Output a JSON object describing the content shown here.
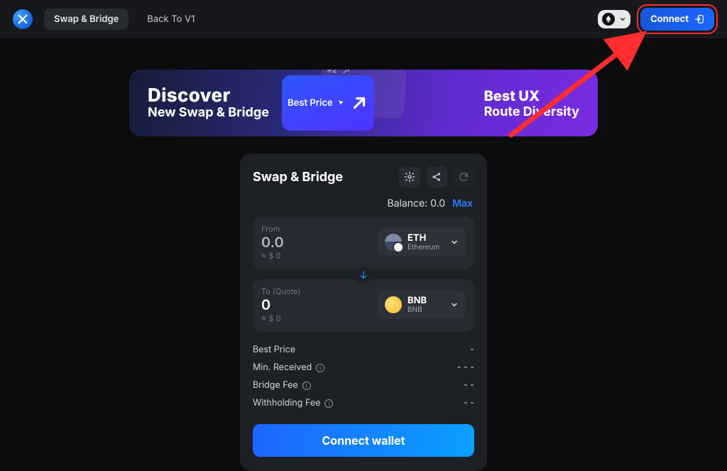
{
  "header": {
    "nav_swap_bridge": "Swap & Bridge",
    "nav_back_v1": "Back To V1",
    "connect_label": "Connect"
  },
  "banner": {
    "discover": "Discover",
    "subtitle": "New Swap & Bridge",
    "card_label": "Best Price",
    "card_back_label": "#2",
    "right1": "Best UX",
    "right2": "Route Diversity"
  },
  "swap": {
    "title": "Swap & Bridge",
    "balance_label": "Balance: 0.0",
    "max": "Max",
    "from": {
      "label": "From",
      "amount": "0.0",
      "usd": "≈ $ 0",
      "token_symbol": "ETH",
      "token_chain": "Ethereum"
    },
    "to": {
      "label": "To (Quote)",
      "amount": "0",
      "usd": "≈ $ 0",
      "token_symbol": "BNB",
      "token_chain": "BNB"
    },
    "meta": {
      "best_price_k": "Best Price",
      "best_price_v": "-",
      "min_recv_k": "Min. Received",
      "min_recv_v": "- - -",
      "bridge_fee_k": "Bridge Fee",
      "bridge_fee_v": "- -",
      "withhold_k": "Withholding Fee",
      "withhold_v": "- -"
    },
    "cta": "Connect wallet"
  }
}
